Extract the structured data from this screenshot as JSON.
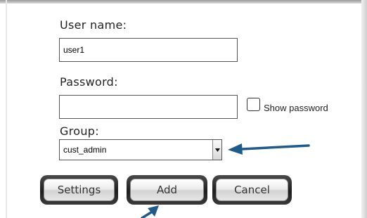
{
  "form": {
    "username": {
      "label": "User name:",
      "value": "user1"
    },
    "password": {
      "label": "Password:",
      "value": ""
    },
    "show_password": {
      "label": "Show password",
      "checked": false
    },
    "group": {
      "label": "Group:",
      "selected": "cust_admin"
    }
  },
  "buttons": {
    "settings": "Settings",
    "add": "Add",
    "cancel": "Cancel"
  },
  "annotations": {
    "arrow_color": "#1f5a8c"
  },
  "icons": {
    "dropdown": "chevron-down-icon",
    "arrow": "callout-arrow-icon"
  }
}
